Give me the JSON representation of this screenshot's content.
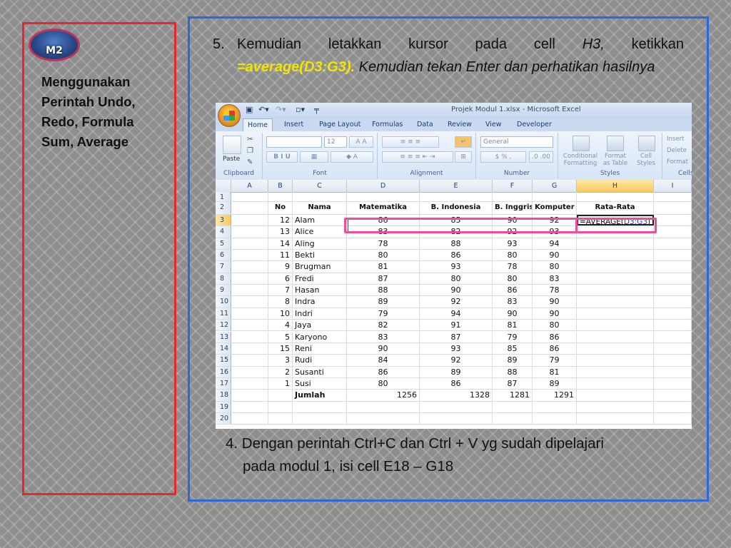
{
  "logo": {
    "text": "M2"
  },
  "left_title": "Menggunakan Perintah Undo, Redo, Formula Sum, Average",
  "step5": {
    "number": "5.",
    "line1": "Kemudian letakkan kursor pada cell H3, ketikkan",
    "formula": "=average(D3:G3).",
    "rest": " Kemudian tekan Enter dan perhatikan hasilnya"
  },
  "step4": {
    "line1": "4. Dengan perintah Ctrl+C dan Ctrl + V yg sudah dipelajari",
    "line2": "pada modul 1, isi cell E18 – G18"
  },
  "excel": {
    "window_title": "Projek Modul 1.xlsx - Microsoft Excel",
    "tabs": [
      "Home",
      "Insert",
      "Page Layout",
      "Formulas",
      "Data",
      "Review",
      "View",
      "Developer"
    ],
    "groups": {
      "clipboard": "Clipboard",
      "font": "Font",
      "alignment": "Alignment",
      "number": "Number",
      "styles": "Styles",
      "cells": "Cells"
    },
    "ribbon": {
      "paste": "Paste",
      "font_size": "12",
      "number_format": "General",
      "conditional_formatting": "Conditional Formatting",
      "format_as_table": "Format as Table",
      "cell_styles": "Cell Styles",
      "insert": "Insert",
      "delete": "Delete",
      "format": "Format"
    },
    "columns": [
      "A",
      "B",
      "C",
      "D",
      "E",
      "F",
      "G",
      "H",
      "I"
    ],
    "header": {
      "no": "No",
      "nama": "Nama",
      "d": "Matematika",
      "e": "B. Indonesia",
      "f": "B. Inggris",
      "g": "Komputer",
      "h": "Rata-Rata"
    },
    "rows": [
      {
        "no": "12",
        "nama": "Alam",
        "d": "86",
        "e": "85",
        "f": "90",
        "g": "92"
      },
      {
        "no": "13",
        "nama": "Alice",
        "d": "83",
        "e": "82",
        "f": "92",
        "g": "93"
      },
      {
        "no": "14",
        "nama": "Aling",
        "d": "78",
        "e": "88",
        "f": "93",
        "g": "94"
      },
      {
        "no": "11",
        "nama": "Bekti",
        "d": "80",
        "e": "86",
        "f": "80",
        "g": "90"
      },
      {
        "no": "9",
        "nama": "Brugman",
        "d": "81",
        "e": "93",
        "f": "78",
        "g": "80"
      },
      {
        "no": "6",
        "nama": "Fredi",
        "d": "87",
        "e": "80",
        "f": "80",
        "g": "83"
      },
      {
        "no": "7",
        "nama": "Hasan",
        "d": "88",
        "e": "90",
        "f": "86",
        "g": "78"
      },
      {
        "no": "8",
        "nama": "Indra",
        "d": "89",
        "e": "92",
        "f": "83",
        "g": "90"
      },
      {
        "no": "10",
        "nama": "Indri",
        "d": "79",
        "e": "94",
        "f": "90",
        "g": "90"
      },
      {
        "no": "4",
        "nama": "Jaya",
        "d": "82",
        "e": "91",
        "f": "81",
        "g": "80"
      },
      {
        "no": "5",
        "nama": "Karyono",
        "d": "83",
        "e": "87",
        "f": "79",
        "g": "86"
      },
      {
        "no": "15",
        "nama": "Reni",
        "d": "90",
        "e": "93",
        "f": "85",
        "g": "86"
      },
      {
        "no": "3",
        "nama": "Rudi",
        "d": "84",
        "e": "92",
        "f": "89",
        "g": "79"
      },
      {
        "no": "2",
        "nama": "Susanti",
        "d": "86",
        "e": "89",
        "f": "88",
        "g": "81"
      },
      {
        "no": "1",
        "nama": "Susi",
        "d": "80",
        "e": "86",
        "f": "87",
        "g": "89"
      }
    ],
    "jumlah": {
      "label": "Jumlah",
      "d": "1256",
      "e": "1328",
      "f": "1281",
      "g": "1291"
    },
    "formula_prefix": "=AVERAGE(",
    "formula_ref": "D3:G3",
    "formula_suffix": ")",
    "row_numbers": [
      "1",
      "2",
      "3",
      "4",
      "5",
      "6",
      "7",
      "8",
      "9",
      "10",
      "11",
      "12",
      "13",
      "14",
      "15",
      "16",
      "17",
      "18",
      "19",
      "20"
    ]
  }
}
